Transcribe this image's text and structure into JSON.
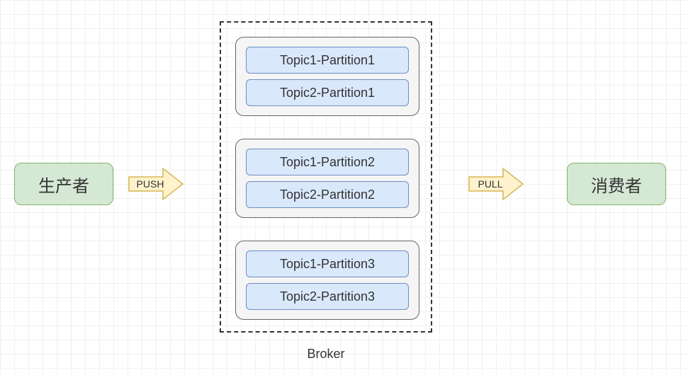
{
  "producer": {
    "label": "生产者"
  },
  "consumer": {
    "label": "消费者"
  },
  "arrows": {
    "push": "PUSH",
    "pull": "PULL"
  },
  "broker": {
    "label": "Broker",
    "groups": [
      {
        "topics": [
          "Topic1-Partition1",
          "Topic2-Partition1"
        ]
      },
      {
        "topics": [
          "Topic1-Partition2",
          "Topic2-Partition2"
        ]
      },
      {
        "topics": [
          "Topic1-Partition3",
          "Topic2-Partition3"
        ]
      }
    ]
  }
}
